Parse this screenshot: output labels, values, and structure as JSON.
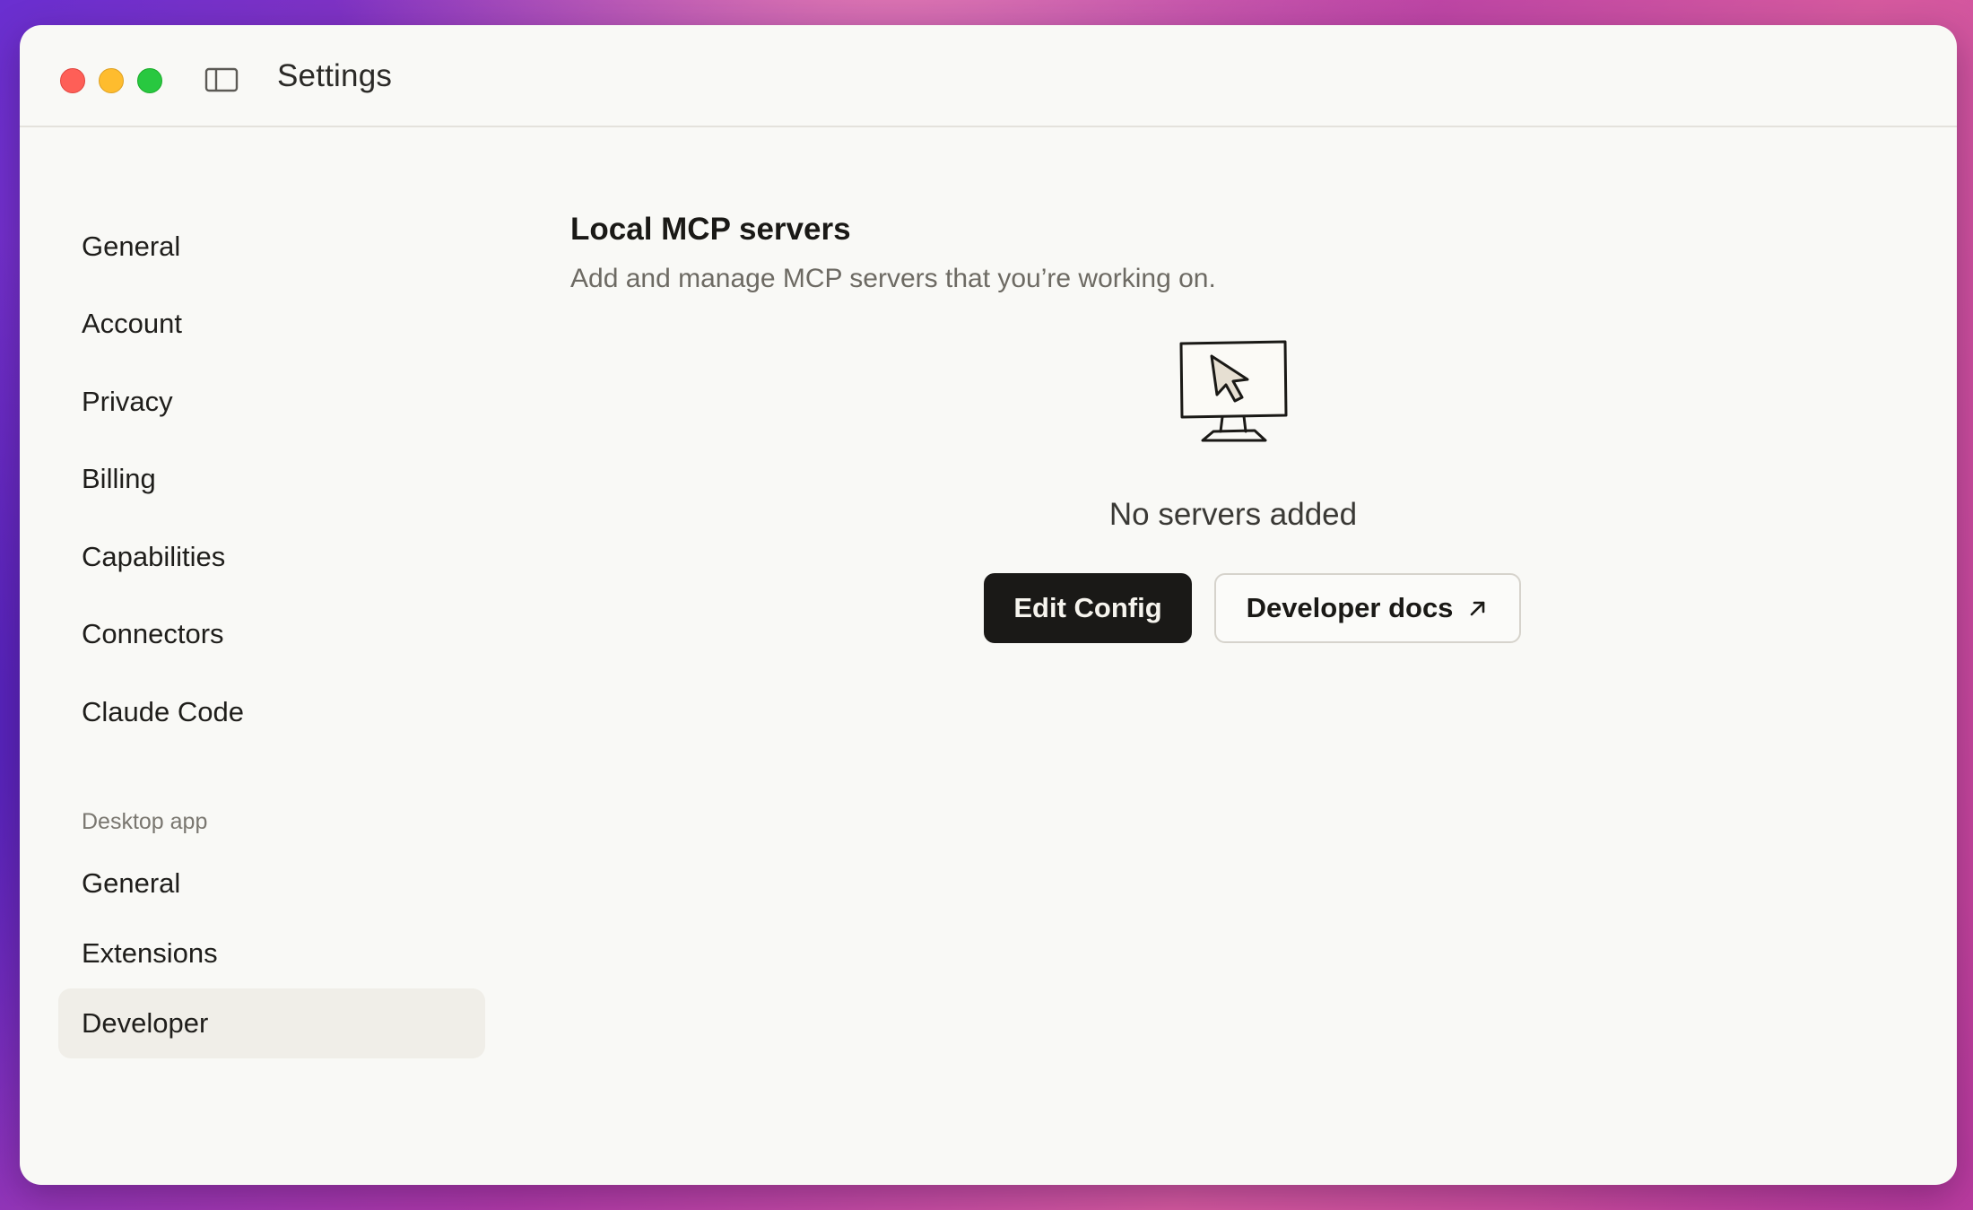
{
  "window": {
    "title": "Settings"
  },
  "sidebar": {
    "items": [
      {
        "label": "General"
      },
      {
        "label": "Account"
      },
      {
        "label": "Privacy"
      },
      {
        "label": "Billing"
      },
      {
        "label": "Capabilities"
      },
      {
        "label": "Connectors"
      },
      {
        "label": "Claude Code"
      }
    ],
    "desktop_section_label": "Desktop app",
    "desktop_items": [
      {
        "label": "General"
      },
      {
        "label": "Extensions"
      },
      {
        "label": "Developer",
        "active": true
      }
    ]
  },
  "main": {
    "title": "Local MCP servers",
    "subtitle": "Add and manage MCP servers that you’re working on.",
    "empty_state": {
      "icon": "monitor-cursor-icon",
      "text": "No servers added"
    },
    "buttons": {
      "edit_config": "Edit Config",
      "developer_docs": "Developer docs"
    }
  },
  "colors": {
    "window_bg": "#f9f9f6",
    "active_item_bg": "#f0eee8",
    "primary_button_bg": "#1a1917",
    "close": "#fe5f57",
    "minimize": "#febc2e",
    "zoom": "#28c840"
  }
}
